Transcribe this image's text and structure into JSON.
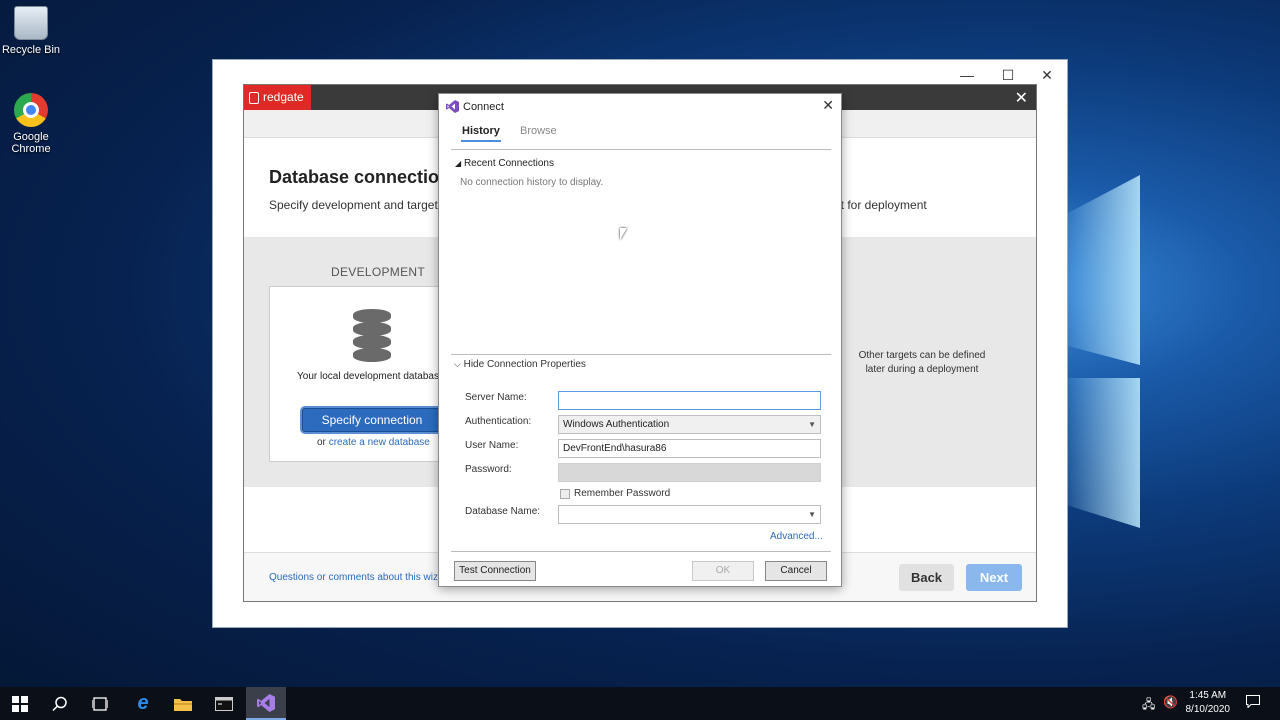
{
  "desktop": {
    "icons": [
      {
        "label": "Recycle Bin"
      },
      {
        "label": "Google Chrome"
      }
    ]
  },
  "outer_window": {
    "minimize": "—",
    "maximize": "☐",
    "close": "✕"
  },
  "redgate": {
    "logo": "redgate",
    "close": "✕",
    "title": "Database connection",
    "subtitle_left": "Specify development and target c",
    "subtitle_right": "ect for deployment",
    "dev_label": "DEVELOPMENT",
    "local_text": "Your local development databas",
    "specify_button": "Specify connection",
    "or_text": "or",
    "create_link": "create a new database",
    "other_targets": "Other targets can be defined later during a deployment",
    "questions": "Questions or comments about this wiz",
    "back": "Back",
    "next": "Next",
    "accent": "#e02826"
  },
  "connect_dialog": {
    "title": "Connect",
    "close": "✕",
    "tabs": [
      {
        "label": "History",
        "active": true
      },
      {
        "label": "Browse",
        "active": false
      }
    ],
    "recent_header": "Recent Connections",
    "no_history": "No connection history to display.",
    "hide_props": "Hide Connection Properties",
    "fields": {
      "server_name_label": "Server Name:",
      "server_name_value": "",
      "auth_label": "Authentication:",
      "auth_value": "Windows Authentication",
      "user_label": "User Name:",
      "user_value": "DevFrontEnd\\hasura86",
      "password_label": "Password:",
      "password_value": "",
      "remember_label": "Remember Password",
      "dbname_label": "Database Name:",
      "dbname_value": ""
    },
    "advanced": "Advanced...",
    "test_button": "Test Connection",
    "ok_button": "OK",
    "cancel_button": "Cancel"
  },
  "taskbar": {
    "time": "1:45 AM",
    "date": "8/10/2020"
  }
}
